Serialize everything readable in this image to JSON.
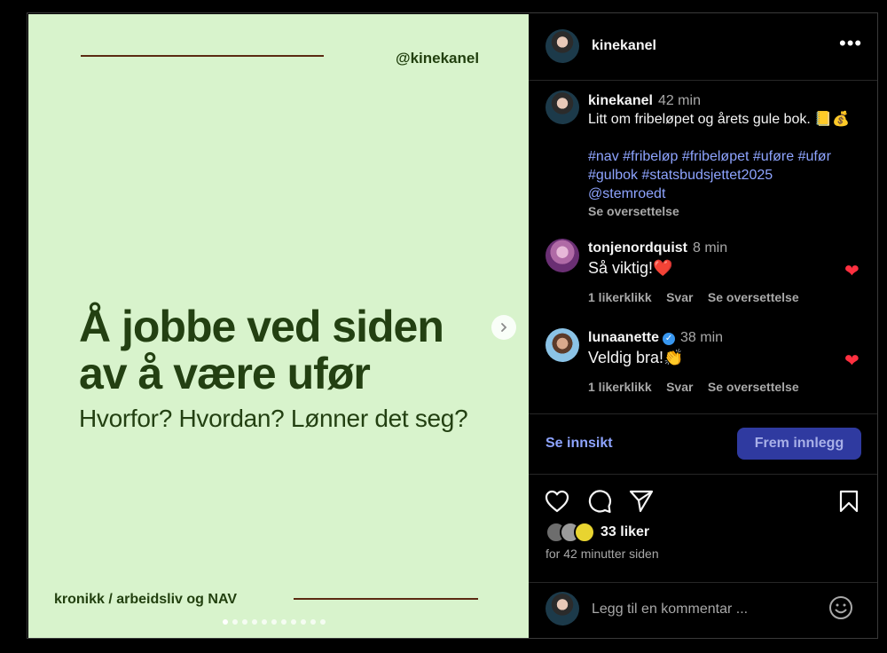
{
  "slide": {
    "handle": "@kinekanel",
    "headline_line1": "Å jobbe ved siden",
    "headline_line2": "av å være ufør",
    "subline": "Hvorfor? Hvordan? Lønner det seg?",
    "footer": "kronikk / arbeidsliv og NAV",
    "dot_count": 11,
    "active_dot": 0
  },
  "header": {
    "username": "kinekanel",
    "more_label": "•••"
  },
  "caption": {
    "username": "kinekanel",
    "time": "42 min",
    "text": "Litt om fribeløpet og årets gule bok. 📒💰",
    "hashtags_line1": "#nav #fribeløp #fribeløpet #uføre #ufør",
    "hashtags_line2": "#gulbok #statsbudsjettet2025",
    "mention": "@stemroedt",
    "translate": "Se oversettelse"
  },
  "comments": [
    {
      "username": "tonjenordquist",
      "time": "8 min",
      "text": "Så viktig!❤️",
      "likes": "1 likerklikk",
      "reply": "Svar",
      "translate": "Se oversettelse"
    },
    {
      "username": "lunaanette",
      "verified": true,
      "time": "38 min",
      "text": "Veldig bra!👏",
      "likes": "1 likerklikk",
      "reply": "Svar",
      "translate": "Se oversettelse"
    }
  ],
  "insight_label": "Se innsikt",
  "boost_label": "Frem innlegg",
  "likes": "33 liker",
  "posted_ago": "for 42 minutter siden",
  "comment_placeholder": "Legg til en kommentar ...",
  "colors": {
    "slide_bg": "#d8f3cc",
    "slide_text": "#234012",
    "accent_line": "#5b2a12",
    "link": "#8ea4ff",
    "heart": "#ff3040",
    "boost_bg": "#2f3aa0"
  }
}
